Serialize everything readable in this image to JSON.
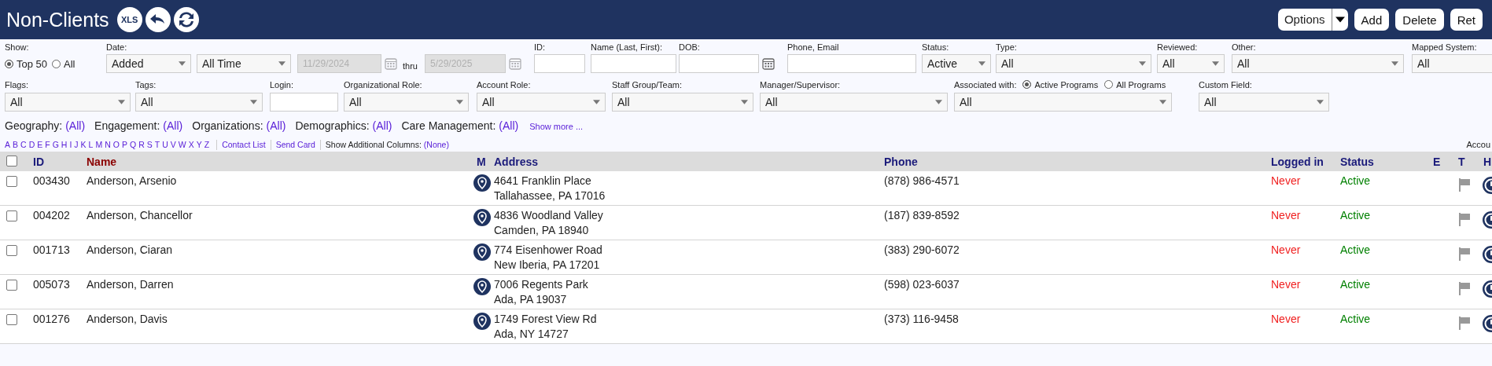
{
  "header": {
    "title": "Non-Clients",
    "xls_label": "XLS",
    "buttons": [
      {
        "label": "Options",
        "kind": "split"
      },
      {
        "label": "Add",
        "kind": "plain"
      },
      {
        "label": "Delete",
        "kind": "plain"
      },
      {
        "label": "Ret",
        "kind": "plain"
      }
    ]
  },
  "filters_row_1": [
    {
      "kind": "radios",
      "label": "Show:",
      "options": [
        {
          "label": "Top 50",
          "selected": true
        },
        {
          "label": "All",
          "selected": false
        }
      ]
    },
    {
      "kind": "dropdown",
      "label": "Date:",
      "value": "Added"
    },
    {
      "kind": "dropdown",
      "value": "All Time"
    },
    {
      "kind": "date",
      "value": "11/29/2024",
      "disabled": true
    },
    {
      "kind": "text",
      "value": "thru"
    },
    {
      "kind": "date",
      "value": "5/29/2025",
      "disabled": true
    },
    {
      "kind": "input",
      "label": "ID:"
    },
    {
      "kind": "input",
      "label": "Name (Last, First):"
    },
    {
      "kind": "date",
      "label": "DOB:",
      "disabled": false
    },
    {
      "kind": "input",
      "label": "Phone, Email"
    },
    {
      "kind": "dropdown",
      "label": "Status:",
      "value": "Active"
    },
    {
      "kind": "dropdown",
      "label": "Type:",
      "value": "All"
    },
    {
      "kind": "dropdown",
      "label": "Reviewed:",
      "value": "All"
    },
    {
      "kind": "dropdown",
      "label": "Other:",
      "value": "All"
    },
    {
      "kind": "dropdown",
      "label": "Mapped System:",
      "value": "All"
    }
  ],
  "filters_row_2": [
    {
      "kind": "dropdown",
      "label": "Flags:",
      "value": "All"
    },
    {
      "kind": "dropdown",
      "label": "Tags:",
      "value": "All"
    },
    {
      "kind": "input",
      "label": "Login:"
    },
    {
      "kind": "dropdown",
      "label": "Organizational Role:",
      "value": "All"
    },
    {
      "kind": "dropdown",
      "label": "Account Role:",
      "value": "All"
    },
    {
      "kind": "dropdown",
      "label": "Staff Group/Team:",
      "value": "All"
    },
    {
      "kind": "dropdown",
      "label": "Manager/Supervisor:",
      "value": "All"
    },
    {
      "kind": "dropdown",
      "label": "Associated with:",
      "value": "All",
      "options": [
        {
          "label": "Active Programs",
          "selected": true
        },
        {
          "label": "All Programs",
          "selected": false
        }
      ]
    },
    {
      "kind": "dropdown",
      "label": "Custom Field:",
      "value": "All"
    }
  ],
  "categories": [
    {
      "label": "Geography:",
      "value": "(All)"
    },
    {
      "label": "Engagement:",
      "value": "(All)"
    },
    {
      "label": "Organizations:",
      "value": "(All)"
    },
    {
      "label": "Demographics:",
      "value": "(All)"
    },
    {
      "label": "Care Management:",
      "value": "(All)"
    }
  ],
  "show_more": "Show more ...",
  "letters": [
    "A",
    "B",
    "C",
    "D",
    "E",
    "F",
    "G",
    "H",
    "I",
    "J",
    "K",
    "L",
    "M",
    "N",
    "O",
    "P",
    "Q",
    "R",
    "S",
    "T",
    "U",
    "V",
    "W",
    "X",
    "Y",
    "Z"
  ],
  "links": [
    "Contact List",
    "Send Card"
  ],
  "additional_columns": {
    "label": "Show Additional Columns:",
    "value": "(None)"
  },
  "account_label": "Accou",
  "table": {
    "select_all_checked": false,
    "columns": [
      "ID",
      "Name",
      "M",
      "Address",
      "Phone",
      "Logged in",
      "Status",
      "E",
      "T",
      "H"
    ],
    "rows": [
      {
        "checked": false,
        "id": "003430",
        "name": "Anderson, Arsenio",
        "address": [
          "4641 Franklin Place",
          "Tallahassee, PA 17016"
        ],
        "phone": "(878) 986-4571",
        "logged_in": "Never",
        "status": "Active"
      },
      {
        "checked": false,
        "id": "004202",
        "name": "Anderson, Chancellor",
        "address": [
          "4836 Woodland Valley",
          "Camden, PA 18940"
        ],
        "phone": "(187) 839-8592",
        "logged_in": "Never",
        "status": "Active"
      },
      {
        "checked": false,
        "id": "001713",
        "name": "Anderson, Ciaran",
        "address": [
          "774 Eisenhower Road",
          "New Iberia, PA 17201"
        ],
        "phone": "(383) 290-6072",
        "logged_in": "Never",
        "status": "Active"
      },
      {
        "checked": false,
        "id": "005073",
        "name": "Anderson, Darren",
        "address": [
          "7006 Regents Park",
          "Ada, PA 19037"
        ],
        "phone": "(598) 023-6037",
        "logged_in": "Never",
        "status": "Active"
      },
      {
        "checked": false,
        "id": "001276",
        "name": "Anderson, Davis",
        "address": [
          "1749 Forest View Rd",
          "Ada, NY 14727"
        ],
        "phone": "(373) 116-9458",
        "logged_in": "Never",
        "status": "Active"
      }
    ]
  }
}
